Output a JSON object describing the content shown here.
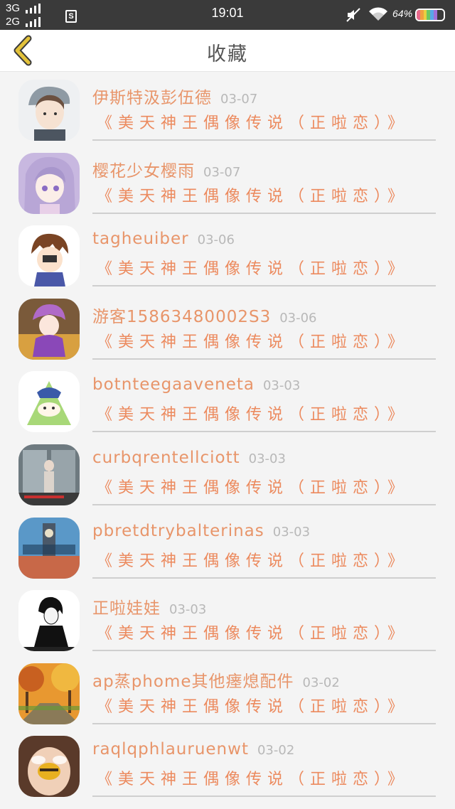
{
  "status_bar": {
    "network_1": "3G",
    "network_2": "2G",
    "sim_label": "S",
    "time": "19:01",
    "battery": "64%",
    "icons": [
      "signal-icon",
      "sim-icon",
      "mute-icon",
      "wifi-icon",
      "battery-icon"
    ]
  },
  "header": {
    "title": "收藏",
    "back_icon": "chevron-left-icon",
    "accent": "#e3c23a"
  },
  "colors": {
    "name": "#e8956a",
    "link": "#ec8a5e",
    "date": "#b8b8b8"
  },
  "items": [
    {
      "name": "伊斯特汲彭伍德",
      "date": "03-07",
      "title": "《美天神王偶像传说（正啦恋）》"
    },
    {
      "name": "樱花少女樱雨",
      "date": "03-07",
      "title": "《美天神王偶像传说（正啦恋）》"
    },
    {
      "name": "tagheuiber",
      "date": "03-06",
      "title": "《美天神王偶像传说（正啦恋）》"
    },
    {
      "name": "游客15863480002S3",
      "date": "03-06",
      "title": "《美天神王偶像传说（正啦恋）》"
    },
    {
      "name": "botnteegaaveneta",
      "date": "03-03",
      "title": "《美天神王偶像传说（正啦恋）》"
    },
    {
      "name": "curbqrentellciott",
      "date": "03-03",
      "title": "《美天神王偶像传说（正啦恋）》"
    },
    {
      "name": "pbretdtrybalterinas",
      "date": "03-03",
      "title": "《美天神王偶像传说（正啦恋）》"
    },
    {
      "name": "正啦娃娃",
      "date": "03-03",
      "title": "《美天神王偶像传说（正啦恋）》"
    },
    {
      "name": "ap蒸phome其他瘗熄配件",
      "date": "03-02",
      "title": "《美天神王偶像传说（正啦恋）》"
    },
    {
      "name": "raqlqphlauruenwt",
      "date": "03-02",
      "title": "《美天神王偶像传说（正啦恋）》"
    }
  ]
}
